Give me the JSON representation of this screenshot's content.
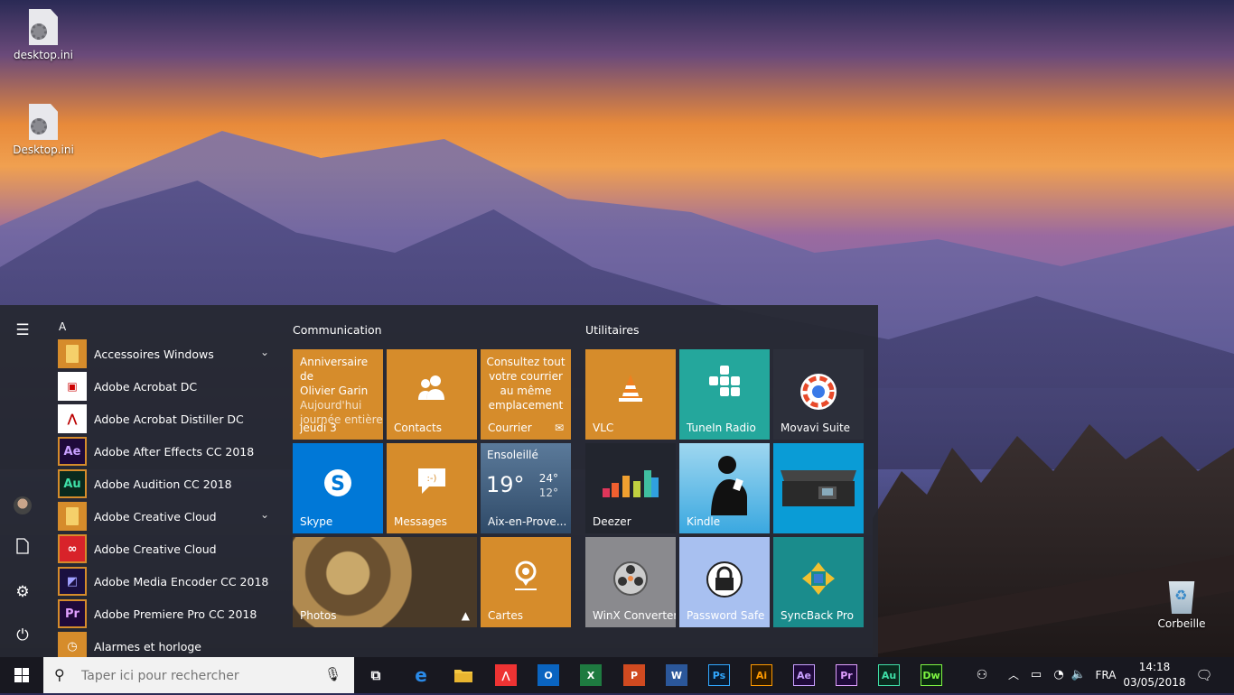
{
  "desktop": {
    "icons": [
      {
        "label": "desktop.ini"
      },
      {
        "label": "Desktop.ini"
      },
      {
        "label": "Corbeille"
      }
    ]
  },
  "start_menu": {
    "letter": "A",
    "apps": [
      {
        "label": "Accessoires Windows",
        "icon": "folder-icon",
        "expandable": true
      },
      {
        "label": "Adobe Acrobat DC",
        "icon": "acrobat-dc-icon"
      },
      {
        "label": "Adobe Acrobat Distiller DC",
        "icon": "acrobat-distiller-icon"
      },
      {
        "label": "Adobe After Effects CC 2018",
        "icon": "after-effects-icon",
        "abbr": "Ae"
      },
      {
        "label": "Adobe Audition CC 2018",
        "icon": "audition-icon",
        "abbr": "Au"
      },
      {
        "label": "Adobe Creative Cloud",
        "icon": "folder-icon",
        "expandable": true
      },
      {
        "label": "Adobe Creative Cloud",
        "icon": "creative-cloud-icon"
      },
      {
        "label": "Adobe Media Encoder CC 2018",
        "icon": "media-encoder-icon"
      },
      {
        "label": "Adobe Premiere Pro CC 2018",
        "icon": "premiere-pro-icon",
        "abbr": "Pr"
      },
      {
        "label": "Alarmes et horloge",
        "icon": "alarm-clock-icon"
      }
    ],
    "groups": [
      {
        "title": "Communication"
      },
      {
        "title": "Utilitaires"
      }
    ],
    "tiles": {
      "calendar": {
        "line1": "Anniversaire de",
        "line2": "Olivier Garin",
        "line3": "Aujourd'hui",
        "line4": "journée entière",
        "label": "jeudi 3"
      },
      "contacts": {
        "label": "Contacts"
      },
      "mail": {
        "text": "Consultez tout votre courrier au même emplacement",
        "label": "Courrier"
      },
      "skype": {
        "label": "Skype"
      },
      "messages": {
        "label": "Messages"
      },
      "weather": {
        "condition": "Ensoleillé",
        "temp": "19°",
        "high": "24°",
        "low": "12°",
        "label": "Aix-en-Prove..."
      },
      "photos": {
        "label": "Photos"
      },
      "maps": {
        "label": "Cartes"
      },
      "vlc": {
        "label": "VLC"
      },
      "tunein": {
        "label": "TuneIn Radio"
      },
      "movavi": {
        "label": "Movavi Suite"
      },
      "deezer": {
        "label": "Deezer"
      },
      "kindle": {
        "label": "Kindle"
      },
      "printer": {
        "label": ""
      },
      "winx": {
        "label": "WinX Converter"
      },
      "password": {
        "label": "Password Safe"
      },
      "syncback": {
        "label": "SyncBack Pro"
      }
    }
  },
  "taskbar": {
    "search_placeholder": "Taper ici pour rechercher",
    "apps": [
      {
        "abbr": "",
        "name": "task-view-icon"
      },
      {
        "abbr": "e",
        "name": "edge-icon"
      },
      {
        "abbr": "",
        "name": "file-explorer-icon"
      },
      {
        "abbr": "",
        "name": "acrobat-icon"
      },
      {
        "abbr": "O",
        "name": "outlook-icon"
      },
      {
        "abbr": "X",
        "name": "excel-icon"
      },
      {
        "abbr": "P",
        "name": "powerpoint-icon"
      },
      {
        "abbr": "W",
        "name": "word-icon"
      },
      {
        "abbr": "Ps",
        "name": "photoshop-icon"
      },
      {
        "abbr": "Ai",
        "name": "illustrator-icon"
      },
      {
        "abbr": "Ae",
        "name": "after-effects-icon"
      },
      {
        "abbr": "Pr",
        "name": "premiere-icon"
      },
      {
        "abbr": "Au",
        "name": "audition-icon"
      },
      {
        "abbr": "Dw",
        "name": "dreamweaver-icon"
      }
    ],
    "language": "FRA",
    "time": "14:18",
    "date": "03/05/2018"
  },
  "colors": {
    "tile_orange": "#d68c2b",
    "tile_blue": "#0078d7",
    "tile_teal": "#24a79c",
    "tile_dark": "#2c2f3a",
    "tile_teal_dark": "#1a8c8c"
  }
}
